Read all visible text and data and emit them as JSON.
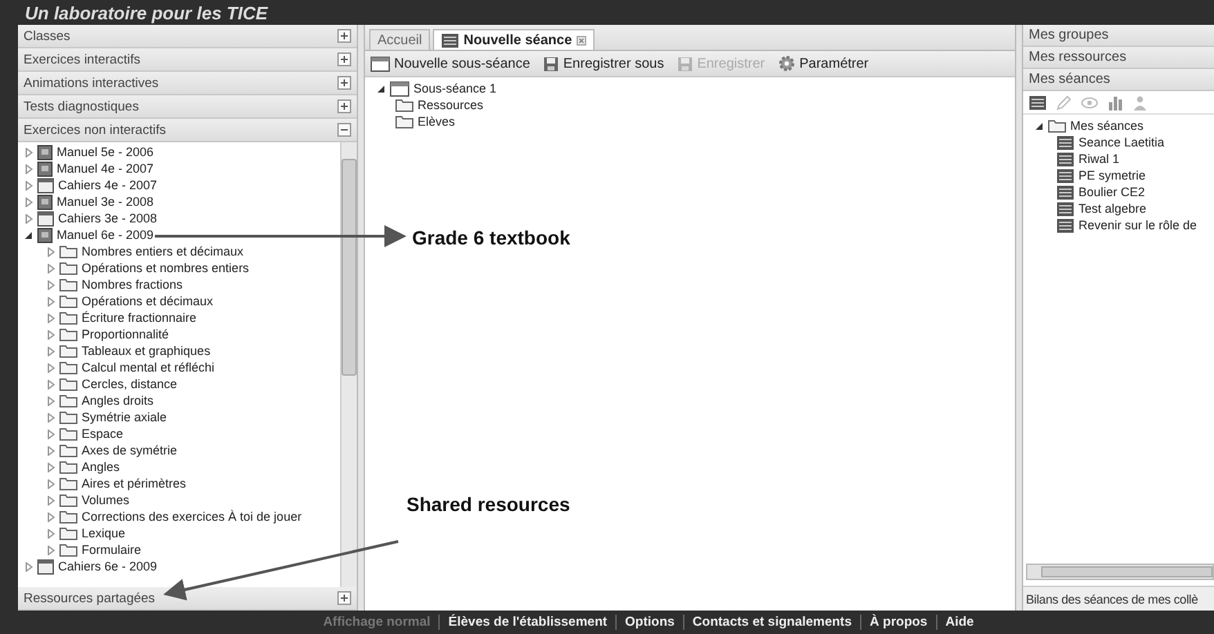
{
  "header": {
    "title": "Un laboratoire pour les TICE"
  },
  "left_panel": {
    "sections": [
      {
        "label": "Classes",
        "expanded": false
      },
      {
        "label": "Exercices interactifs",
        "expanded": false
      },
      {
        "label": "Animations interactives",
        "expanded": false
      },
      {
        "label": "Tests diagnostiques",
        "expanded": false
      },
      {
        "label": "Exercices non interactifs",
        "expanded": true
      }
    ],
    "tree": [
      {
        "label": "Manuel 5e - 2006",
        "kind": "manuel",
        "expanded": false
      },
      {
        "label": "Manuel 4e - 2007",
        "kind": "manuel",
        "expanded": false
      },
      {
        "label": "Cahiers 4e - 2007",
        "kind": "cahier",
        "expanded": false
      },
      {
        "label": "Manuel 3e - 2008",
        "kind": "manuel",
        "expanded": false
      },
      {
        "label": "Cahiers 3e - 2008",
        "kind": "cahier",
        "expanded": false
      },
      {
        "label": "Manuel 6e - 2009",
        "kind": "manuel",
        "expanded": true,
        "children": [
          {
            "label": "Nombres entiers et décimaux",
            "kind": "folder",
            "expanded": false
          },
          {
            "label": "Opérations et nombres entiers",
            "kind": "folder",
            "expanded": false
          },
          {
            "label": "Nombres fractions",
            "kind": "folder",
            "expanded": false
          },
          {
            "label": "Opérations et décimaux",
            "kind": "folder",
            "expanded": false
          },
          {
            "label": "Écriture fractionnaire",
            "kind": "folder",
            "expanded": false
          },
          {
            "label": "Proportionnalité",
            "kind": "folder",
            "expanded": false
          },
          {
            "label": "Tableaux et graphiques",
            "kind": "folder",
            "expanded": false
          },
          {
            "label": "Calcul mental et réfléchi",
            "kind": "folder",
            "expanded": false
          },
          {
            "label": "Cercles, distance",
            "kind": "folder",
            "expanded": false
          },
          {
            "label": "Angles droits",
            "kind": "folder",
            "expanded": false
          },
          {
            "label": "Symétrie axiale",
            "kind": "folder",
            "expanded": false
          },
          {
            "label": "Espace",
            "kind": "folder",
            "expanded": false
          },
          {
            "label": "Axes de symétrie",
            "kind": "folder",
            "expanded": false
          },
          {
            "label": "Angles",
            "kind": "folder",
            "expanded": false
          },
          {
            "label": "Aires et périmètres",
            "kind": "folder",
            "expanded": false
          },
          {
            "label": "Volumes",
            "kind": "folder",
            "expanded": false
          },
          {
            "label": "Corrections des exercices À toi de jouer",
            "kind": "folder",
            "expanded": false
          },
          {
            "label": "Lexique",
            "kind": "folder",
            "expanded": false
          },
          {
            "label": "Formulaire",
            "kind": "folder",
            "expanded": false
          }
        ]
      },
      {
        "label": "Cahiers 6e - 2009",
        "kind": "cahier",
        "expanded": false
      }
    ],
    "footer_section": {
      "label": "Ressources partagées",
      "expanded": false
    }
  },
  "center_panel": {
    "tabs": [
      {
        "label": "Accueil",
        "selected": false
      },
      {
        "label": "Nouvelle séance",
        "selected": true
      }
    ],
    "toolbar": [
      {
        "label": "Nouvelle sous-séance",
        "kind": "new",
        "disabled": false
      },
      {
        "label": "Enregistrer sous",
        "kind": "save",
        "disabled": false
      },
      {
        "label": "Enregistrer",
        "kind": "save",
        "disabled": true
      },
      {
        "label": "Paramétrer",
        "kind": "gear",
        "disabled": false
      }
    ],
    "tree": {
      "label": "Sous-séance 1",
      "expanded": true,
      "children": [
        {
          "label": "Ressources"
        },
        {
          "label": "Elèves"
        }
      ]
    }
  },
  "right_panel": {
    "sections": [
      {
        "label": "Mes groupes"
      },
      {
        "label": "Mes ressources"
      },
      {
        "label": "Mes séances"
      }
    ],
    "tree": {
      "label": "Mes séances",
      "expanded": true,
      "children": [
        {
          "label": "Seance Laetitia"
        },
        {
          "label": "Riwal 1"
        },
        {
          "label": "PE symetrie"
        },
        {
          "label": "Boulier CE2"
        },
        {
          "label": "Test algebre"
        },
        {
          "label": "Revenir sur le rôle de"
        }
      ]
    },
    "footer_section": {
      "label": "Bilans des séances de mes collè"
    }
  },
  "footer_menu": [
    {
      "label": "Affichage normal",
      "disabled": true
    },
    {
      "label": "Élèves de l'établissement",
      "disabled": false
    },
    {
      "label": "Options",
      "disabled": false
    },
    {
      "label": "Contacts et signalements",
      "disabled": false
    },
    {
      "label": "À propos",
      "disabled": false
    },
    {
      "label": "Aide",
      "disabled": false
    }
  ],
  "annotations": [
    {
      "text": "Grade 6 textbook"
    },
    {
      "text": "Shared resources"
    }
  ]
}
